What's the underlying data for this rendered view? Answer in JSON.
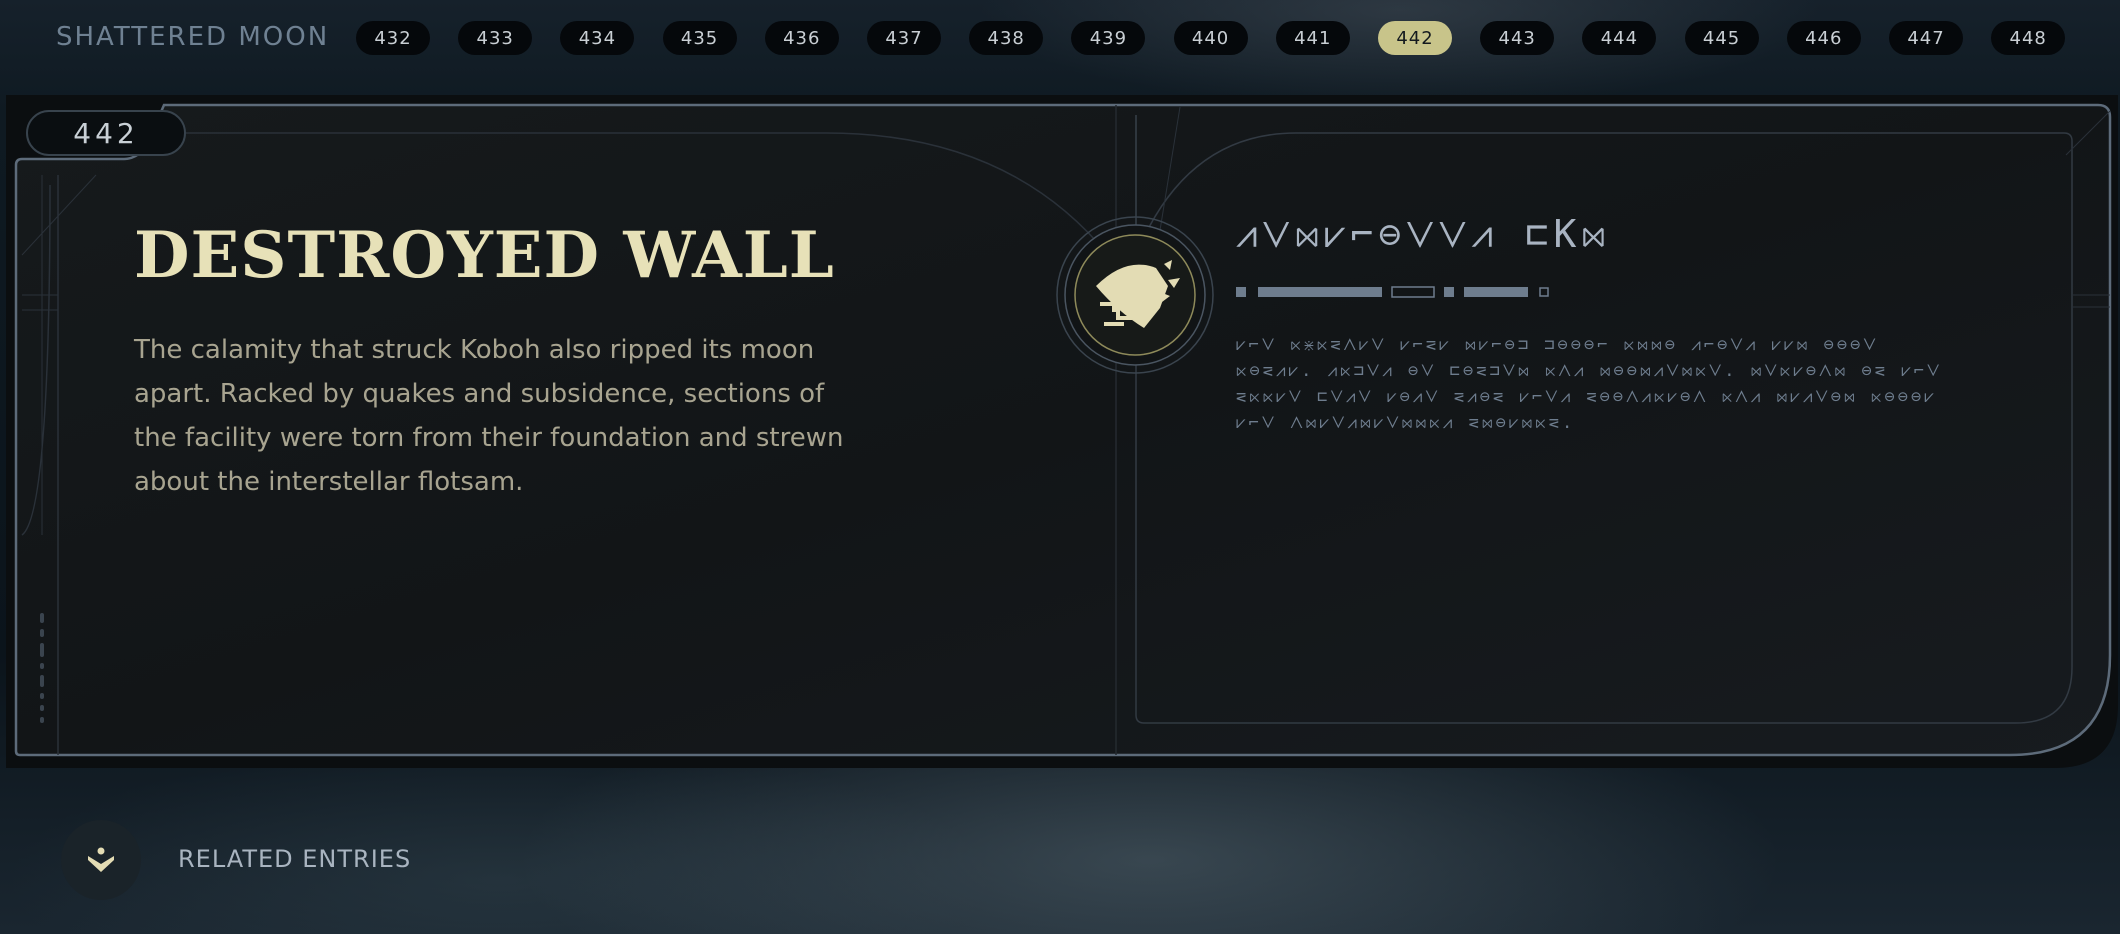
{
  "header": {
    "section_title": "SHATTERED MOON",
    "pages": [
      "432",
      "433",
      "434",
      "435",
      "436",
      "437",
      "438",
      "439",
      "440",
      "441",
      "442",
      "443",
      "444",
      "445",
      "446",
      "447",
      "448"
    ],
    "active_page": "442"
  },
  "entry": {
    "id": "442",
    "title": "DESTROYED WALL",
    "description": "The calamity that struck Koboh also ripped its moon apart. Racked by quakes and subsidence, sections of the facility were torn from their foundation and strewn about the interstellar flotsam.",
    "emblem_icon": "shattered-moon-emblem-icon",
    "aurebesh_title": "⩘⋁⋈⩗⌐⊖⋁⋁⩘ ⊏K⋈",
    "aurebesh_body": "⩗⌐⋁ ⋉⋇⋉⋜⋀⩗⋁ ⩗⌐⋜⩗ ⋈⩗⌐⊖⊐ ⊐⊖⊖⊖⌐ ⋉⋈⋈⊖ ⩘⌐⊖⋁⩘ ⩗⩗⋈ ⊖⊖⊖⋁ ⋉⊖⋜⩘⩗. ⩘⋉⊐⋁⩘ ⊖⋁ ⊏⊖⋜⊐⋁⋈ ⋉⋀⩘ ⋈⊖⊖⋈⩘⋁⋈⋉⋁. ⋈⋁⋉⩗⊖⋀⋈ ⊖⋜ ⩗⌐⋁ ⋜⋉⋉⩗⋁ ⊏⋁⩘⋁ ⩗⊖⩘⋁ ⋜⩘⊖⋜ ⩗⌐⋁⩘ ⋜⊖⊖⋀⩘⋉⩗⊖⋀ ⋉⋀⩘ ⋈⩗⩘⋁⊖⋈ ⋉⊖⊖⊖⩗ ⩗⌐⋁ ⋀⋈⩗⋁⩘⋈⩗⋁⋈⋈⋉⩘ ⋜⋈⊖⩗⋈⋉⋜."
  },
  "footer": {
    "related_label": "RELATED ENTRIES",
    "related_icon": "related-entries-icon"
  },
  "colors": {
    "accent": "#c8c48a",
    "title": "#e7e1b8",
    "body_text": "#a8a490",
    "frame_line": "#5d6b7a"
  }
}
